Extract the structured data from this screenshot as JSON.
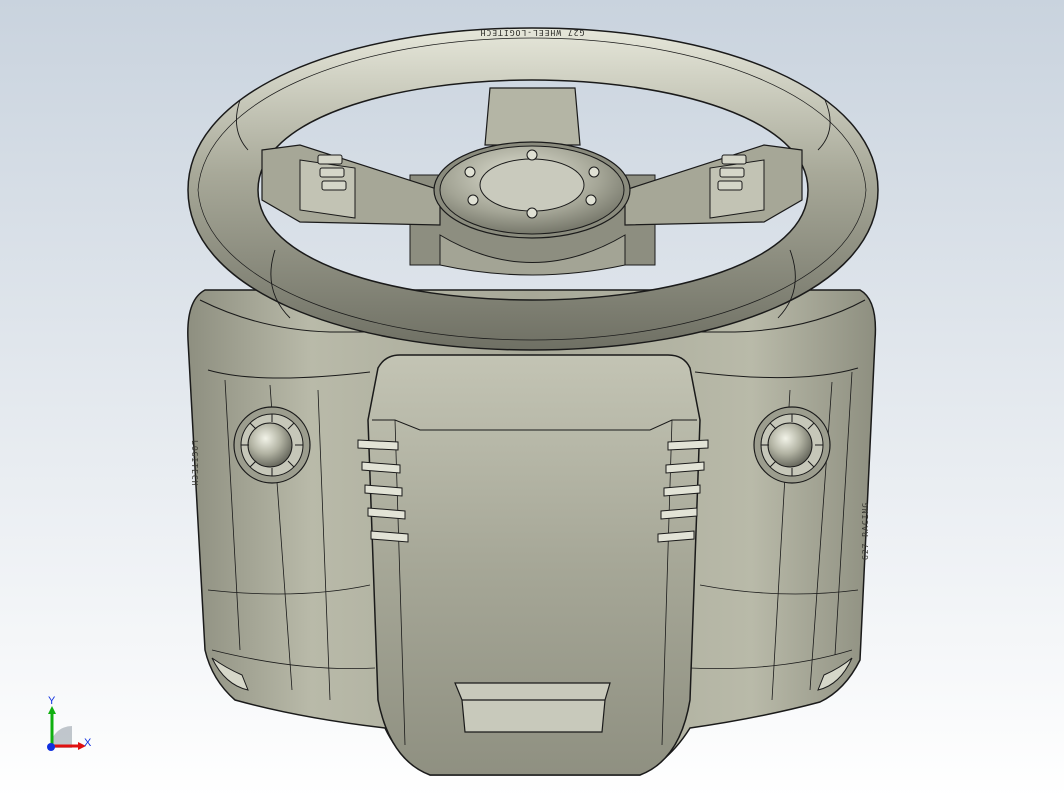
{
  "viewport": {
    "background_top": "#c9d3de",
    "background_bottom": "#ffffff"
  },
  "model": {
    "body_color": "#a9aa9a",
    "edge_color": "#1a1a1a",
    "wheel_rim_lettering": "G27 WHEEL-LOGITECH",
    "left_body_lettering": "LOGITECH",
    "right_body_lettering": "G27 RACING"
  },
  "triad": {
    "x_label": "X",
    "y_label": "Y",
    "x_color": "#e01010",
    "y_color": "#10b010",
    "z_color": "#1030e0"
  }
}
